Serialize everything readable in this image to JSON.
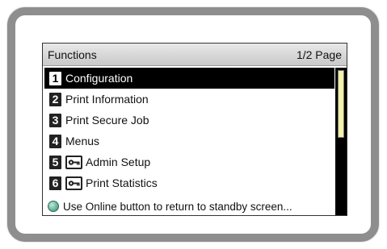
{
  "header": {
    "title": "Functions",
    "page_indicator": "1/2 Page"
  },
  "menu": {
    "items": [
      {
        "number": "1",
        "label": "Configuration",
        "selected": true,
        "key_icon": false
      },
      {
        "number": "2",
        "label": "Print Information",
        "selected": false,
        "key_icon": false
      },
      {
        "number": "3",
        "label": "Print Secure Job",
        "selected": false,
        "key_icon": false
      },
      {
        "number": "4",
        "label": "Menus",
        "selected": false,
        "key_icon": false
      },
      {
        "number": "5",
        "label": "Admin Setup",
        "selected": false,
        "key_icon": true
      },
      {
        "number": "6",
        "label": "Print Statistics",
        "selected": false,
        "key_icon": true
      }
    ]
  },
  "footer": {
    "hint": "Use Online button to return to standby screen..."
  },
  "scrollbar": {
    "position_fraction": 0.0,
    "visible_fraction": 0.5
  },
  "colors": {
    "selected_bg": "#000000",
    "scroll_thumb": "#f4f1a8",
    "online_indicator": "#58a98e",
    "bezel": "#8e8e8e"
  }
}
